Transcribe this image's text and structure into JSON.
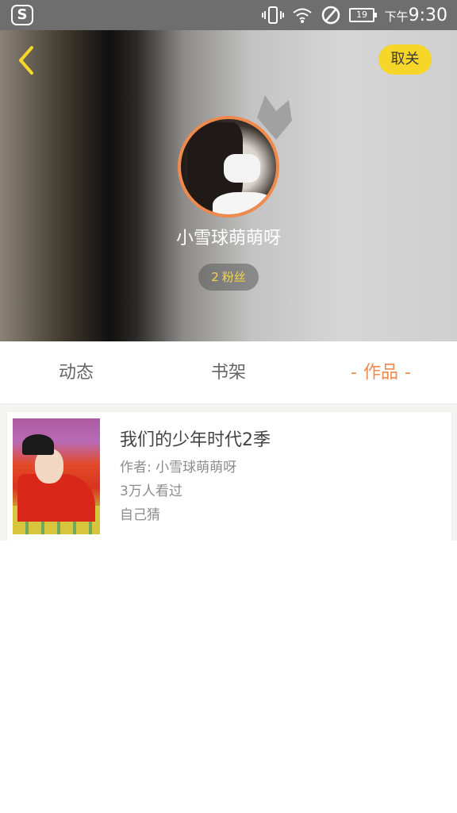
{
  "status_bar": {
    "app_icon_letter": "S",
    "battery_level": "19",
    "time_ampm": "下午",
    "time": "9:30"
  },
  "header": {
    "follow_label": "取关",
    "username": "小雪球萌萌呀",
    "fans_count": "2",
    "fans_label": "粉丝"
  },
  "tabs": [
    {
      "label": "动态"
    },
    {
      "label": "书架"
    },
    {
      "label": "作品",
      "active": true
    }
  ],
  "works": [
    {
      "title": "我们的少年时代2季",
      "author": "作者: 小雪球萌萌呀",
      "views": "3万人看过",
      "tag": "自己猜"
    }
  ],
  "colors": {
    "accent": "#f08a4c",
    "follow_button": "#f5d629",
    "fans_text": "#f3d44a"
  }
}
